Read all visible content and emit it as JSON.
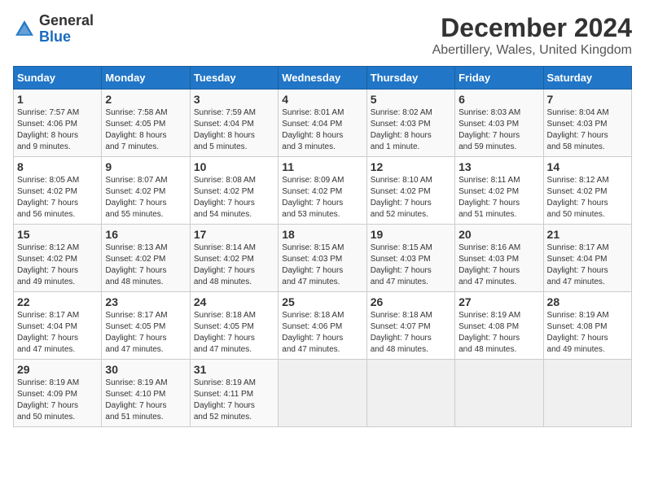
{
  "header": {
    "logo_general": "General",
    "logo_blue": "Blue",
    "main_title": "December 2024",
    "subtitle": "Abertillery, Wales, United Kingdom"
  },
  "columns": [
    "Sunday",
    "Monday",
    "Tuesday",
    "Wednesday",
    "Thursday",
    "Friday",
    "Saturday"
  ],
  "weeks": [
    [
      {
        "day": "1",
        "info": "Sunrise: 7:57 AM\nSunset: 4:06 PM\nDaylight: 8 hours\nand 9 minutes."
      },
      {
        "day": "2",
        "info": "Sunrise: 7:58 AM\nSunset: 4:05 PM\nDaylight: 8 hours\nand 7 minutes."
      },
      {
        "day": "3",
        "info": "Sunrise: 7:59 AM\nSunset: 4:04 PM\nDaylight: 8 hours\nand 5 minutes."
      },
      {
        "day": "4",
        "info": "Sunrise: 8:01 AM\nSunset: 4:04 PM\nDaylight: 8 hours\nand 3 minutes."
      },
      {
        "day": "5",
        "info": "Sunrise: 8:02 AM\nSunset: 4:03 PM\nDaylight: 8 hours\nand 1 minute."
      },
      {
        "day": "6",
        "info": "Sunrise: 8:03 AM\nSunset: 4:03 PM\nDaylight: 7 hours\nand 59 minutes."
      },
      {
        "day": "7",
        "info": "Sunrise: 8:04 AM\nSunset: 4:03 PM\nDaylight: 7 hours\nand 58 minutes."
      }
    ],
    [
      {
        "day": "8",
        "info": "Sunrise: 8:05 AM\nSunset: 4:02 PM\nDaylight: 7 hours\nand 56 minutes."
      },
      {
        "day": "9",
        "info": "Sunrise: 8:07 AM\nSunset: 4:02 PM\nDaylight: 7 hours\nand 55 minutes."
      },
      {
        "day": "10",
        "info": "Sunrise: 8:08 AM\nSunset: 4:02 PM\nDaylight: 7 hours\nand 54 minutes."
      },
      {
        "day": "11",
        "info": "Sunrise: 8:09 AM\nSunset: 4:02 PM\nDaylight: 7 hours\nand 53 minutes."
      },
      {
        "day": "12",
        "info": "Sunrise: 8:10 AM\nSunset: 4:02 PM\nDaylight: 7 hours\nand 52 minutes."
      },
      {
        "day": "13",
        "info": "Sunrise: 8:11 AM\nSunset: 4:02 PM\nDaylight: 7 hours\nand 51 minutes."
      },
      {
        "day": "14",
        "info": "Sunrise: 8:12 AM\nSunset: 4:02 PM\nDaylight: 7 hours\nand 50 minutes."
      }
    ],
    [
      {
        "day": "15",
        "info": "Sunrise: 8:12 AM\nSunset: 4:02 PM\nDaylight: 7 hours\nand 49 minutes."
      },
      {
        "day": "16",
        "info": "Sunrise: 8:13 AM\nSunset: 4:02 PM\nDaylight: 7 hours\nand 48 minutes."
      },
      {
        "day": "17",
        "info": "Sunrise: 8:14 AM\nSunset: 4:02 PM\nDaylight: 7 hours\nand 48 minutes."
      },
      {
        "day": "18",
        "info": "Sunrise: 8:15 AM\nSunset: 4:03 PM\nDaylight: 7 hours\nand 47 minutes."
      },
      {
        "day": "19",
        "info": "Sunrise: 8:15 AM\nSunset: 4:03 PM\nDaylight: 7 hours\nand 47 minutes."
      },
      {
        "day": "20",
        "info": "Sunrise: 8:16 AM\nSunset: 4:03 PM\nDaylight: 7 hours\nand 47 minutes."
      },
      {
        "day": "21",
        "info": "Sunrise: 8:17 AM\nSunset: 4:04 PM\nDaylight: 7 hours\nand 47 minutes."
      }
    ],
    [
      {
        "day": "22",
        "info": "Sunrise: 8:17 AM\nSunset: 4:04 PM\nDaylight: 7 hours\nand 47 minutes."
      },
      {
        "day": "23",
        "info": "Sunrise: 8:17 AM\nSunset: 4:05 PM\nDaylight: 7 hours\nand 47 minutes."
      },
      {
        "day": "24",
        "info": "Sunrise: 8:18 AM\nSunset: 4:05 PM\nDaylight: 7 hours\nand 47 minutes."
      },
      {
        "day": "25",
        "info": "Sunrise: 8:18 AM\nSunset: 4:06 PM\nDaylight: 7 hours\nand 47 minutes."
      },
      {
        "day": "26",
        "info": "Sunrise: 8:18 AM\nSunset: 4:07 PM\nDaylight: 7 hours\nand 48 minutes."
      },
      {
        "day": "27",
        "info": "Sunrise: 8:19 AM\nSunset: 4:08 PM\nDaylight: 7 hours\nand 48 minutes."
      },
      {
        "day": "28",
        "info": "Sunrise: 8:19 AM\nSunset: 4:08 PM\nDaylight: 7 hours\nand 49 minutes."
      }
    ],
    [
      {
        "day": "29",
        "info": "Sunrise: 8:19 AM\nSunset: 4:09 PM\nDaylight: 7 hours\nand 50 minutes."
      },
      {
        "day": "30",
        "info": "Sunrise: 8:19 AM\nSunset: 4:10 PM\nDaylight: 7 hours\nand 51 minutes."
      },
      {
        "day": "31",
        "info": "Sunrise: 8:19 AM\nSunset: 4:11 PM\nDaylight: 7 hours\nand 52 minutes."
      },
      {
        "day": "",
        "info": ""
      },
      {
        "day": "",
        "info": ""
      },
      {
        "day": "",
        "info": ""
      },
      {
        "day": "",
        "info": ""
      }
    ]
  ]
}
